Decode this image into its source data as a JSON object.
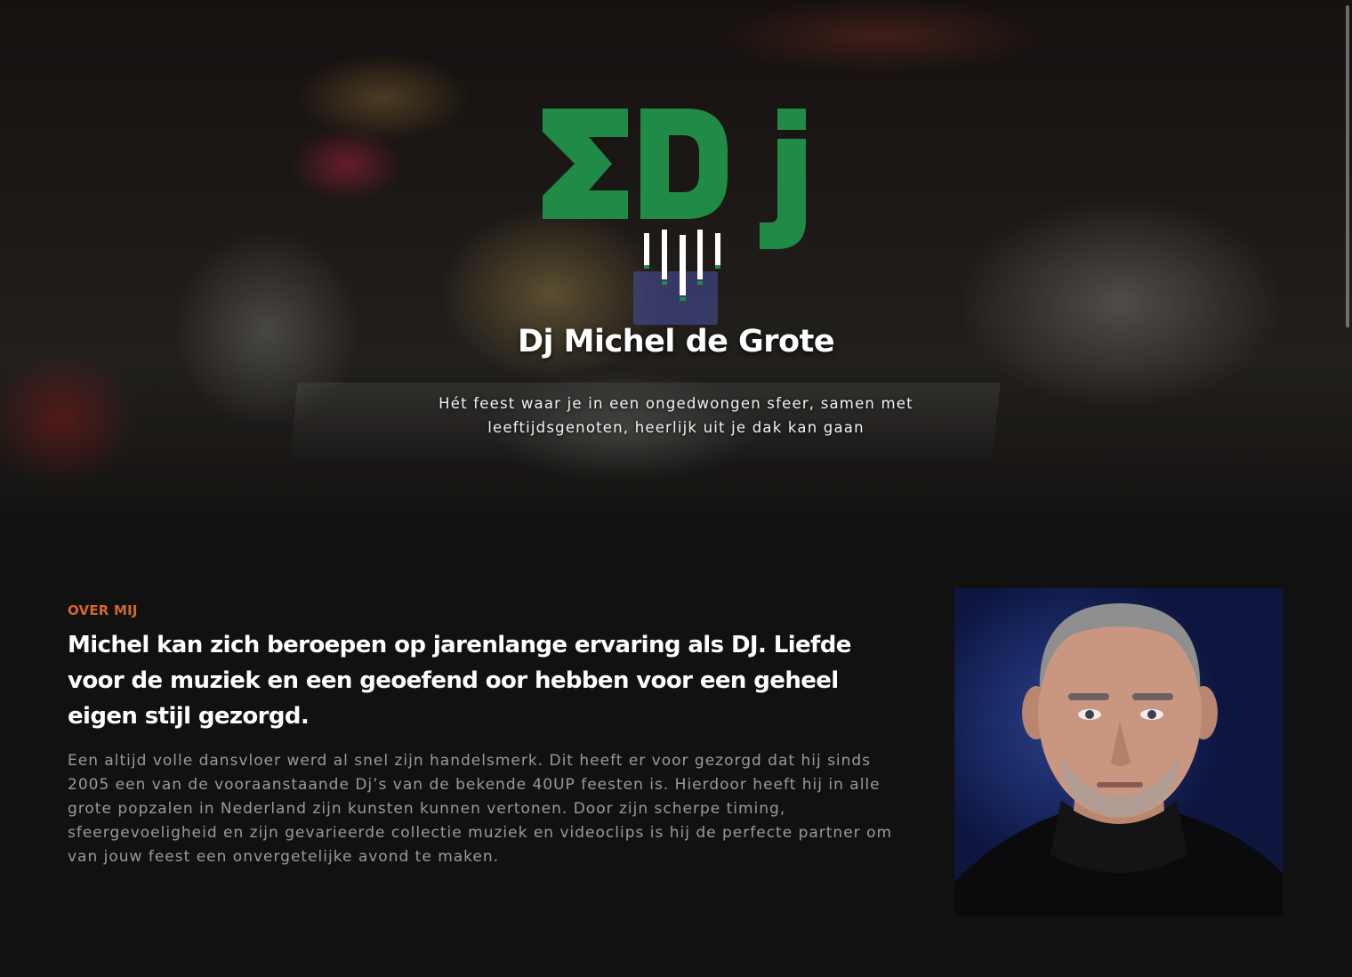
{
  "hero": {
    "logo_alt": "EDj logo",
    "title": "Dj Michel de Grote",
    "subtitle": "Hét feest waar je in een ongedwongen sfeer, samen met leeftijdsgenoten, heerlijk uit je dak kan gaan",
    "logo_color": "#1f8b47",
    "logo_accent_color": "#ffffff"
  },
  "about": {
    "eyebrow": "OVER MIJ",
    "heading": "Michel kan zich beroepen op jarenlange ervaring als DJ. Liefde voor de muziek en een geoefend oor hebben voor een geheel eigen stijl gezorgd.",
    "body": "Een altijd volle dansvloer werd al snel zijn handelsmerk. Dit heeft er voor gezorgd dat hij sinds 2005 een van de vooraanstaande Dj’s van de bekende 40UP feesten is. Hierdoor heeft hij in alle grote popzalen in Nederland zijn kunsten kunnen vertonen. Door zijn scherpe timing, sfeergevoeligheid en zijn gevarieerde collectie muziek en videoclips is hij de perfecte partner om van jouw feest een onvergetelijke avond te maken.",
    "portrait_alt": "Portret van Michel de Grote",
    "eyebrow_color": "#d2692a"
  }
}
